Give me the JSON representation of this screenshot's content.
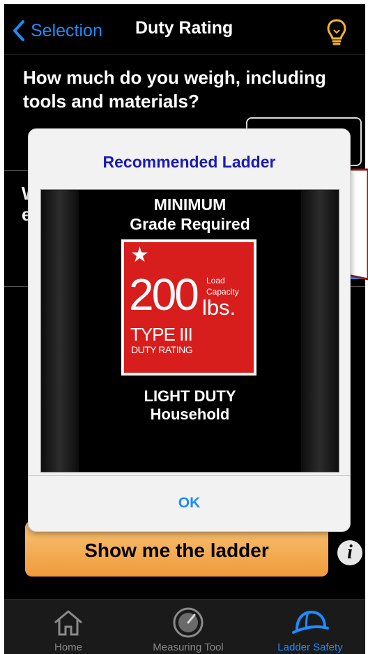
{
  "nav": {
    "back_label": "Selection",
    "title": "Duty Rating",
    "right_icon": "lightbulb-icon"
  },
  "question": "How much do you weigh, including tools and materials?",
  "bg_partial_1": "W",
  "bg_partial_2": "e",
  "show_button": "Show me the ladder",
  "info_label": "i",
  "dialog": {
    "title": "Recommended Ladder",
    "image": {
      "line1": "MINIMUM",
      "line2": "Grade Required",
      "capacity": "200",
      "load": "Load",
      "capacity_label": "Capacity",
      "unit": "lbs.",
      "type": "TYPE III",
      "duty_rating": "DUTY RATING",
      "duty_class": "LIGHT DUTY",
      "use": "Household"
    },
    "ok": "OK"
  },
  "tabs": [
    {
      "label": "Home",
      "icon": "home-icon",
      "active": false
    },
    {
      "label": "Measuring Tool",
      "icon": "gauge-icon",
      "active": false
    },
    {
      "label": "Ladder Safety",
      "icon": "hard-hat-icon",
      "active": true
    }
  ],
  "colors": {
    "accent": "#1e8cff",
    "dialog_title": "#1a1ab5",
    "badge_red": "#d81d1d",
    "button_orange": "#f09a3c"
  }
}
